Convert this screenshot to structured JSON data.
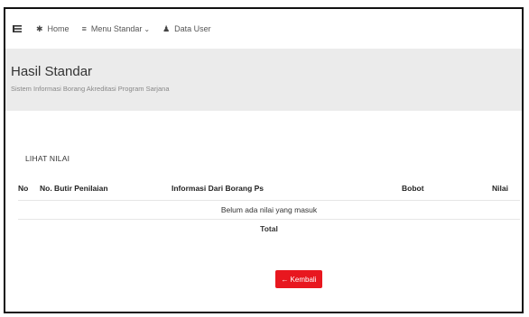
{
  "nav": {
    "home": "Home",
    "menu_standar": "Menu Standar",
    "data_user": "Data User"
  },
  "header": {
    "title": "Hasil Standar",
    "subtitle": "Sistem Informasi Borang Akreditasi Program Sarjana"
  },
  "section": {
    "title": "LIHAT NILAI"
  },
  "table": {
    "columns": [
      "No",
      "No. Butir Penilaian",
      "Informasi Dari Borang Ps",
      "Bobot",
      "Nilai"
    ],
    "empty_message": "Belum ada nilai yang masuk",
    "total_label": "Total"
  },
  "actions": {
    "back_arrow": "←",
    "back_label": "Kembali"
  },
  "colors": {
    "back_button": "#e8171f",
    "header_bg": "#ebebeb"
  },
  "icons": {
    "toggle": "menu-toggle-icon",
    "home": "home-icon",
    "menu": "list-icon",
    "user": "user-icon"
  }
}
